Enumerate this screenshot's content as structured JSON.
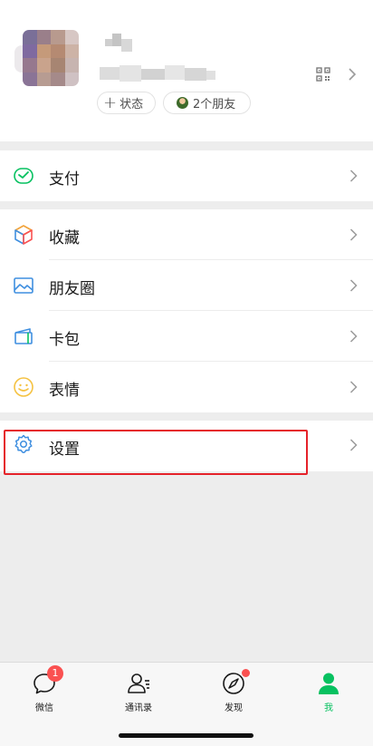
{
  "profile": {
    "status_pill": {
      "plus": "+",
      "label": "状态"
    },
    "friends_pill": {
      "label": "2个朋友"
    },
    "icons": {
      "qr": "qr-code-icon",
      "chevron": "chevron-right-icon"
    }
  },
  "menu": {
    "pay": {
      "label": "支付",
      "icon": "pay-icon",
      "color": "#07c160"
    },
    "favorites": {
      "label": "收藏",
      "icon": "favorites-cube-icon",
      "colors": [
        "#f2a33a",
        "#3f8fe0",
        "#fa5151"
      ]
    },
    "moments": {
      "label": "朋友圈",
      "icon": "moments-image-icon",
      "color": "#3f8fe0"
    },
    "cards": {
      "label": "卡包",
      "icon": "card-wallet-icon",
      "color": "#3f8fe0"
    },
    "stickers": {
      "label": "表情",
      "icon": "sticker-smile-icon",
      "color": "#f5c242"
    },
    "settings": {
      "label": "设置",
      "icon": "settings-gear-icon",
      "color": "#3f8fe0"
    }
  },
  "tabbar": {
    "chats": {
      "label": "微信",
      "badge": "1",
      "icon": "chat-bubble-icon"
    },
    "contacts": {
      "label": "通讯录",
      "icon": "contacts-icon"
    },
    "discover": {
      "label": "发现",
      "icon": "compass-icon"
    },
    "me": {
      "label": "我",
      "icon": "person-icon",
      "active": true
    }
  },
  "colors": {
    "accent": "#07c160",
    "highlight": "#e5222a",
    "badge": "#fa5151"
  }
}
